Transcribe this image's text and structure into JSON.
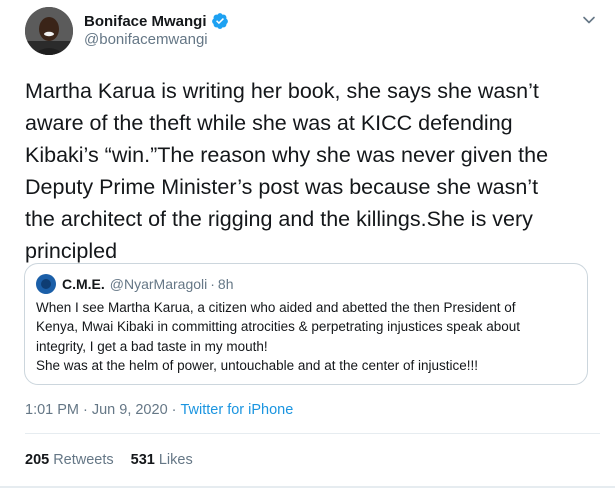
{
  "author": {
    "name": "Boniface Mwangi",
    "handle": "@bonifacemwangi",
    "verified": true,
    "avatar_icon": "profile-photo",
    "menu_icon": "chevron-down-icon"
  },
  "tweet": {
    "lines": [
      "Martha Karua is writing her book, she says she wasn’t",
      "aware of the theft while she was at KICC defending",
      "Kibaki’s “win.”The reason why she was never given the",
      "Deputy Prime Minister’s post was because she wasn’t",
      "the architect of the rigging and the killings.She is very",
      "principled"
    ]
  },
  "quoted_tweet": {
    "name": "C.M.E.",
    "handle": "@NyarMaragoli",
    "separator": "·",
    "time": "8h",
    "lines": [
      "When I see Martha Karua, a citizen who aided and abetted the then President of",
      "Kenya, Mwai Kibaki in committing atrocities & perpetrating injustices speak about",
      "integrity, I get a bad taste in my mouth!",
      "She was at the helm of power, untouchable and at the center of injustice!!!"
    ]
  },
  "meta": {
    "time": "1:01 PM",
    "date": "Jun 9, 2020",
    "separator": "·",
    "source": "Twitter for iPhone"
  },
  "stats": {
    "retweets_count": "205",
    "retweets_label": "Retweets",
    "likes_count": "531",
    "likes_label": "Likes"
  },
  "colors": {
    "text": "#14171a",
    "secondary": "#657786",
    "accent": "#1b95e0",
    "border": "#ccd6dd"
  }
}
